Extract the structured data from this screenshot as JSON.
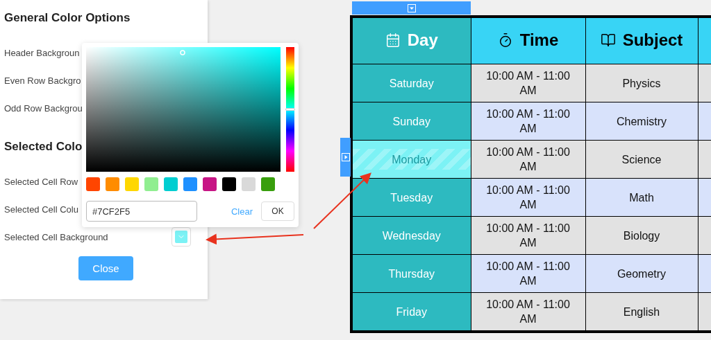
{
  "settings_panel": {
    "sections": [
      {
        "title": "General Color Options",
        "items": [
          {
            "label": "Header Backgroun"
          },
          {
            "label": "Even Row Backgro"
          },
          {
            "label": "Odd Row Backgrou"
          }
        ]
      },
      {
        "title": "Selected Colo",
        "items": [
          {
            "label": "Selected Cell Row"
          },
          {
            "label": "Selected Cell Colu"
          },
          {
            "label": "Selected Cell Background",
            "color": "#7cf2f5"
          }
        ]
      }
    ],
    "close_button": "Close"
  },
  "color_picker": {
    "hue": {
      "level": 0.5
    },
    "presets": [
      {
        "color": "#ff4500"
      },
      {
        "color": "#ff8c00"
      },
      {
        "color": "#ffd700"
      },
      {
        "color": "#90ee90"
      },
      {
        "color": "#00ced1"
      },
      {
        "color": "#1e90ff"
      },
      {
        "color": "#c71585"
      },
      {
        "color": "#000000"
      },
      {
        "color": "#d9d9d9"
      },
      {
        "color": "#389e0d"
      }
    ],
    "value": "#7CF2F5",
    "clear": "Clear",
    "ok": "OK"
  },
  "table": {
    "columns": [
      {
        "label": "Day",
        "kind": "day"
      },
      {
        "label": "Time",
        "kind": "time"
      },
      {
        "label": "Subject",
        "kind": "subject"
      }
    ],
    "rows": [
      {
        "cells": [
          "Saturday",
          "10:00 AM - 11:00 AM",
          "Physics"
        ],
        "selected": false
      },
      {
        "cells": [
          "Sunday",
          "10:00 AM - 11:00 AM",
          "Chemistry"
        ],
        "selected": false
      },
      {
        "cells": [
          "Monday",
          "10:00 AM - 11:00 AM",
          "Science"
        ],
        "selected": true
      },
      {
        "cells": [
          "Tuesday",
          "10:00 AM - 11:00 AM",
          "Math"
        ],
        "selected": false
      },
      {
        "cells": [
          "Wednesday",
          "10:00 AM - 11:00 AM",
          "Biology"
        ],
        "selected": false
      },
      {
        "cells": [
          "Thursday",
          "10:00 AM - 11:00 AM",
          "Geometry"
        ],
        "selected": false
      },
      {
        "cells": [
          "Friday",
          "10:00 AM - 11:00 AM",
          "English"
        ],
        "selected": false
      }
    ]
  }
}
